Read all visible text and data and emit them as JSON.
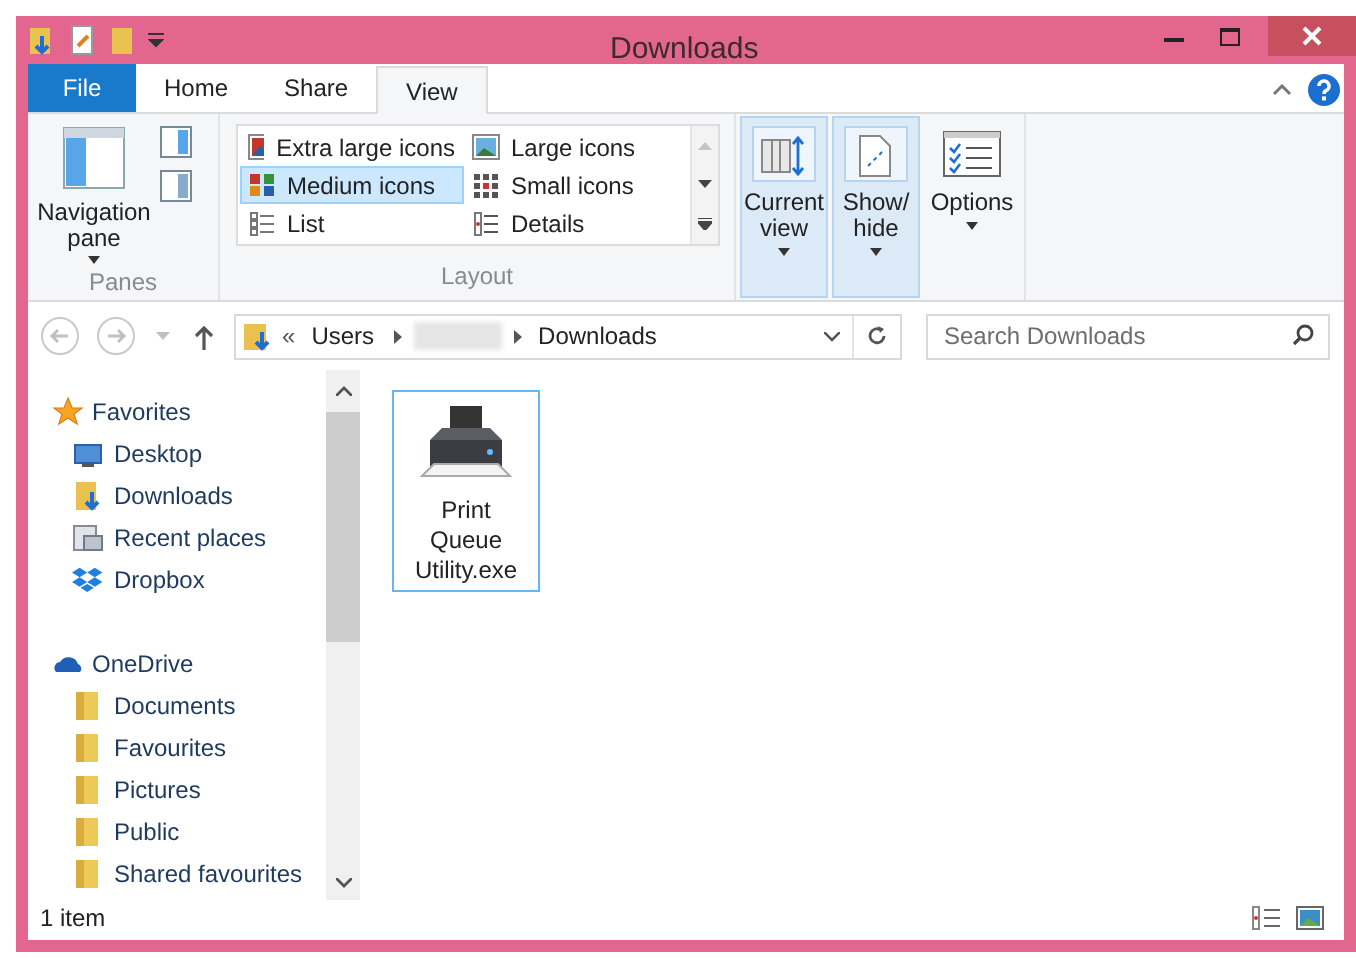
{
  "window": {
    "title": "Downloads"
  },
  "tabs": [
    {
      "label": "File",
      "kind": "file",
      "selected": false
    },
    {
      "label": "Home",
      "kind": "tab",
      "selected": false
    },
    {
      "label": "Share",
      "kind": "tab",
      "selected": false
    },
    {
      "label": "View",
      "kind": "tab",
      "selected": true
    }
  ],
  "ribbon": {
    "panes": {
      "label": "Panes",
      "navigation_pane": "Navigation\npane"
    },
    "layout": {
      "label": "Layout",
      "options": [
        {
          "label": "Extra large icons",
          "kind": "xl",
          "selected": false
        },
        {
          "label": "Large icons",
          "kind": "large",
          "selected": false
        },
        {
          "label": "Medium icons",
          "kind": "medium",
          "selected": true
        },
        {
          "label": "Small icons",
          "kind": "small",
          "selected": false
        },
        {
          "label": "List",
          "kind": "list",
          "selected": false
        },
        {
          "label": "Details",
          "kind": "details",
          "selected": false
        }
      ]
    },
    "view_buttons": [
      {
        "label": "Current\nview",
        "kind": "current",
        "highlighted": true
      },
      {
        "label": "Show/\nhide",
        "kind": "showhide",
        "highlighted": true
      },
      {
        "label": "Options",
        "kind": "options",
        "highlighted": false
      }
    ]
  },
  "address_bar": {
    "prefix": "«",
    "segments": [
      "Users",
      "Downloads"
    ]
  },
  "search": {
    "placeholder": "Search Downloads"
  },
  "navigation": [
    {
      "label": "Favorites",
      "kind": "star",
      "children": [
        {
          "label": "Desktop",
          "kind": "desktop"
        },
        {
          "label": "Downloads",
          "kind": "downloads"
        },
        {
          "label": "Recent places",
          "kind": "recent"
        },
        {
          "label": "Dropbox",
          "kind": "dropbox"
        }
      ]
    },
    {
      "label": "OneDrive",
      "kind": "cloud",
      "children": [
        {
          "label": "Documents",
          "kind": "folder"
        },
        {
          "label": "Favourites",
          "kind": "folder"
        },
        {
          "label": "Pictures",
          "kind": "folder"
        },
        {
          "label": "Public",
          "kind": "folder"
        },
        {
          "label": "Shared favourites",
          "kind": "folder"
        }
      ]
    }
  ],
  "files": [
    {
      "name": "Print Queue Utility.exe",
      "selected": true
    }
  ],
  "status_bar": {
    "text": "1 item"
  }
}
